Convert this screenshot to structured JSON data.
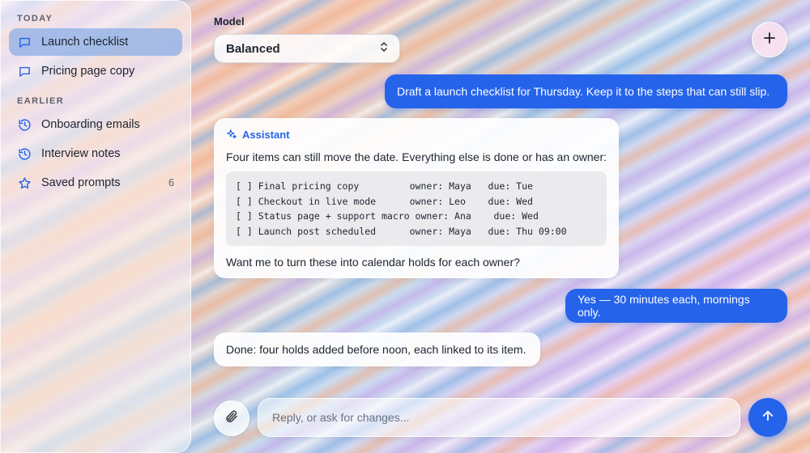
{
  "sidebar": {
    "today_label": "TODAY",
    "today_items": [
      {
        "label": "Launch checklist",
        "icon": "chat-bubble-icon",
        "active": true
      },
      {
        "label": "Pricing page copy",
        "icon": "chat-bubble-icon"
      }
    ],
    "earlier_label": "EARLIER",
    "earlier_items": [
      {
        "label": "Onboarding emails",
        "icon": "history-icon"
      },
      {
        "label": "Interview notes",
        "icon": "history-icon"
      },
      {
        "label": "Saved prompts",
        "icon": "star-icon",
        "count": "6"
      }
    ]
  },
  "model": {
    "label": "Model",
    "selected": "Balanced"
  },
  "conversation": {
    "user_message_1": "Draft a launch checklist for Thursday. Keep it to the steps that can still slip.",
    "assistant_name": "Assistant",
    "assistant_intro": "Four items can still move the date. Everything else is done or has an owner:",
    "checklist": [
      "[ ] Final pricing copy         owner: Maya   due: Tue",
      "[ ] Checkout in live mode      owner: Leo    due: Wed",
      "[ ] Status page + support macro owner: Ana    due: Wed",
      "[ ] Launch post scheduled      owner: Maya   due: Thu 09:00"
    ],
    "assistant_outro": "Want me to turn these into calendar holds for each owner?",
    "user_message_2": "Yes — 30 minutes each, mornings only.",
    "assistant_reply": "Done: four holds added before noon, each linked to its item."
  },
  "composer": {
    "placeholder": "Reply, or ask for changes..."
  },
  "colors": {
    "accent": "#2563eb",
    "active_item": "#8cafe6"
  }
}
